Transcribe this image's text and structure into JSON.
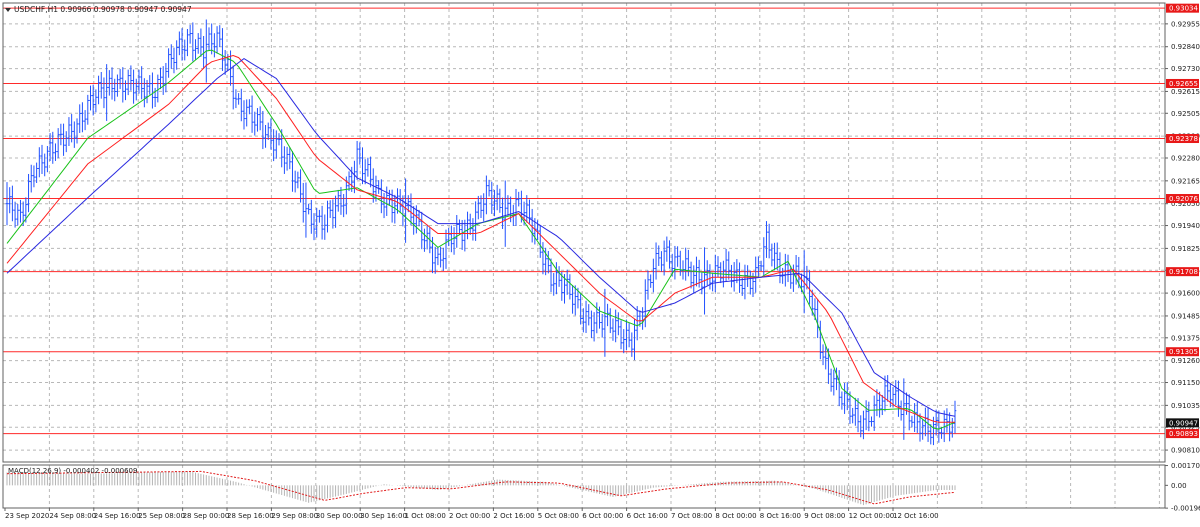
{
  "header": {
    "symbol_line": "USDCHF,H1  0.90966 0.90978 0.90947 0.90947"
  },
  "colors": {
    "background": "#ffffff",
    "grid": "#b8b8b8",
    "candles": "#2050ff",
    "ma_fast": "#19c219",
    "ma_mid": "#ff2020",
    "ma_slow": "#2a2ae0",
    "level_line": "#ff2a2a",
    "level_label_bg": "#e81818",
    "price_label_bg": "#101010",
    "macd_hist": "#b4b4b4",
    "macd_signal": "#e01818"
  },
  "chart_data": [
    {
      "type": "line",
      "title": "",
      "series_style": "candlestick-bars",
      "grid": true,
      "x": [
        "23 Sep 2020",
        "24 Sep 08:00",
        "24 Sep 16:00",
        "25 Sep 08:00",
        "28 Sep 00:00",
        "28 Sep 16:00",
        "29 Sep 08:00",
        "30 Sep 00:00",
        "30 Sep 16:00",
        "1 Oct 08:00",
        "2 Oct 00:00",
        "2 Oct 16:00",
        "5 Oct 08:00",
        "6 Oct 00:00",
        "6 Oct 16:00",
        "7 Oct 08:00",
        "8 Oct 00:00",
        "8 Oct 16:00",
        "9 Oct 08:00",
        "12 Oct 00:00",
        "12 Oct 16:00"
      ],
      "ylim": [
        0.9075,
        0.9306
      ],
      "y_ticks": [
        "0.92955",
        "0.92840",
        "0.92730",
        "0.92615",
        "0.92505",
        "0.92390",
        "0.92280",
        "0.92165",
        "0.92050",
        "0.91940",
        "0.91825",
        "0.91715",
        "0.91600",
        "0.91485",
        "0.91375",
        "0.91260",
        "0.91150",
        "0.91035",
        "0.90925",
        "0.90810"
      ],
      "y_tick_values": [
        0.92955,
        0.9284,
        0.9273,
        0.92615,
        0.92505,
        0.9239,
        0.9228,
        0.92165,
        0.9205,
        0.9194,
        0.91825,
        0.91715,
        0.916,
        0.91485,
        0.91375,
        0.9126,
        0.9115,
        0.91035,
        0.90925,
        0.9081
      ],
      "levels": [
        {
          "label": "0.93034",
          "value": 0.93034
        },
        {
          "label": "0.92655",
          "value": 0.92655
        },
        {
          "label": "0.92378",
          "value": 0.92378
        },
        {
          "label": "0.92076",
          "value": 0.92076
        },
        {
          "label": "0.91708",
          "value": 0.91708
        },
        {
          "label": "0.91305",
          "value": 0.91305
        },
        {
          "label": "0.90893",
          "value": 0.90893
        }
      ],
      "current_price": {
        "label": "0.90947",
        "value": 0.90947
      },
      "price_keypoints": [
        [
          0,
          0.9205
        ],
        [
          5,
          0.9195
        ],
        [
          10,
          0.9225
        ],
        [
          18,
          0.9232
        ],
        [
          25,
          0.9245
        ],
        [
          33,
          0.9258
        ],
        [
          40,
          0.9268
        ],
        [
          48,
          0.9262
        ],
        [
          55,
          0.9264
        ],
        [
          62,
          0.9278
        ],
        [
          68,
          0.929
        ],
        [
          73,
          0.9283
        ],
        [
          78,
          0.9286
        ],
        [
          82,
          0.9275
        ],
        [
          86,
          0.9255
        ],
        [
          92,
          0.9245
        ],
        [
          100,
          0.9238
        ],
        [
          106,
          0.9218
        ],
        [
          112,
          0.92
        ],
        [
          118,
          0.9195
        ],
        [
          124,
          0.9205
        ],
        [
          130,
          0.923
        ],
        [
          134,
          0.9218
        ],
        [
          138,
          0.9208
        ],
        [
          144,
          0.9207
        ],
        [
          150,
          0.9198
        ],
        [
          156,
          0.9188
        ],
        [
          160,
          0.9176
        ],
        [
          166,
          0.9188
        ],
        [
          172,
          0.9196
        ],
        [
          178,
          0.9208
        ],
        [
          184,
          0.9203
        ],
        [
          190,
          0.9205
        ],
        [
          196,
          0.919
        ],
        [
          202,
          0.917
        ],
        [
          208,
          0.916
        ],
        [
          214,
          0.915
        ],
        [
          220,
          0.9145
        ],
        [
          226,
          0.9142
        ],
        [
          232,
          0.9138
        ],
        [
          236,
          0.915
        ],
        [
          240,
          0.9173
        ],
        [
          244,
          0.9183
        ],
        [
          248,
          0.9176
        ],
        [
          254,
          0.9168
        ],
        [
          260,
          0.917
        ],
        [
          266,
          0.917
        ],
        [
          272,
          0.9168
        ],
        [
          278,
          0.9168
        ],
        [
          282,
          0.9184
        ],
        [
          286,
          0.9175
        ],
        [
          292,
          0.917
        ],
        [
          298,
          0.916
        ],
        [
          304,
          0.9125
        ],
        [
          310,
          0.9105
        ],
        [
          316,
          0.9097
        ],
        [
          322,
          0.91
        ],
        [
          328,
          0.911
        ],
        [
          334,
          0.9103
        ],
        [
          338,
          0.9092
        ],
        [
          342,
          0.909
        ],
        [
          346,
          0.9095
        ],
        [
          352,
          0.9095
        ]
      ],
      "series": [
        {
          "values": [
            [
              0,
              0.9185
            ],
            [
              30,
              0.9238
            ],
            [
              60,
              0.9266
            ],
            [
              75,
              0.9283
            ],
            [
              85,
              0.9276
            ],
            [
              100,
              0.9245
            ],
            [
              115,
              0.921
            ],
            [
              130,
              0.9213
            ],
            [
              145,
              0.9202
            ],
            [
              160,
              0.9183
            ],
            [
              175,
              0.9195
            ],
            [
              190,
              0.92
            ],
            [
              205,
              0.917
            ],
            [
              220,
              0.9151
            ],
            [
              235,
              0.9143
            ],
            [
              248,
              0.9172
            ],
            [
              262,
              0.917
            ],
            [
              280,
              0.9168
            ],
            [
              290,
              0.9176
            ],
            [
              300,
              0.9148
            ],
            [
              310,
              0.9112
            ],
            [
              320,
              0.9101
            ],
            [
              335,
              0.9102
            ],
            [
              345,
              0.9091
            ],
            [
              352,
              0.9095
            ]
          ]
        },
        {
          "values": [
            [
              0,
              0.9175
            ],
            [
              30,
              0.9225
            ],
            [
              60,
              0.9255
            ],
            [
              75,
              0.9276
            ],
            [
              85,
              0.928
            ],
            [
              100,
              0.9258
            ],
            [
              115,
              0.9228
            ],
            [
              130,
              0.9212
            ],
            [
              145,
              0.9206
            ],
            [
              160,
              0.919
            ],
            [
              175,
              0.919
            ],
            [
              190,
              0.92
            ],
            [
              205,
              0.918
            ],
            [
              220,
              0.916
            ],
            [
              235,
              0.9145
            ],
            [
              248,
              0.916
            ],
            [
              262,
              0.9168
            ],
            [
              280,
              0.9168
            ],
            [
              292,
              0.9172
            ],
            [
              305,
              0.915
            ],
            [
              318,
              0.9115
            ],
            [
              330,
              0.9103
            ],
            [
              345,
              0.9095
            ],
            [
              352,
              0.9095
            ]
          ]
        },
        {
          "values": [
            [
              0,
              0.917
            ],
            [
              30,
              0.9208
            ],
            [
              60,
              0.9245
            ],
            [
              78,
              0.9268
            ],
            [
              88,
              0.9278
            ],
            [
              100,
              0.9268
            ],
            [
              115,
              0.924
            ],
            [
              130,
              0.9218
            ],
            [
              145,
              0.9208
            ],
            [
              160,
              0.9195
            ],
            [
              175,
              0.9195
            ],
            [
              190,
              0.9201
            ],
            [
              205,
              0.9188
            ],
            [
              220,
              0.9168
            ],
            [
              235,
              0.915
            ],
            [
              248,
              0.9155
            ],
            [
              262,
              0.9165
            ],
            [
              280,
              0.9168
            ],
            [
              295,
              0.917
            ],
            [
              310,
              0.915
            ],
            [
              322,
              0.912
            ],
            [
              335,
              0.9108
            ],
            [
              345,
              0.91
            ],
            [
              352,
              0.9098
            ]
          ]
        }
      ]
    },
    {
      "type": "bar",
      "title": "MACD(12,26,9) -0.000402 -0.000609",
      "ylim": [
        -0.00195,
        0.00175
      ],
      "y_ticks": [
        "0.001704",
        "0.00",
        "-0.001961"
      ],
      "y_tick_values": [
        0.001704,
        0.0,
        -0.001961
      ],
      "hist_keypoints": [
        [
          0,
          0.0011
        ],
        [
          30,
          0.001
        ],
        [
          68,
          0.0012
        ],
        [
          85,
          0.0003
        ],
        [
          112,
          -0.0015
        ],
        [
          125,
          -0.0008
        ],
        [
          140,
          0.0001
        ],
        [
          160,
          -0.0004
        ],
        [
          182,
          0.0005
        ],
        [
          200,
          0.0003
        ],
        [
          225,
          -0.001
        ],
        [
          240,
          -0.0002
        ],
        [
          265,
          0.0003
        ],
        [
          285,
          0.0004
        ],
        [
          300,
          -0.0003
        ],
        [
          318,
          -0.0017
        ],
        [
          330,
          -0.0009
        ],
        [
          345,
          -0.0004
        ],
        [
          352,
          -0.0004
        ]
      ],
      "signal_keypoints": [
        [
          0,
          0.001
        ],
        [
          35,
          0.0011
        ],
        [
          72,
          0.0012
        ],
        [
          92,
          0.0004
        ],
        [
          118,
          -0.0013
        ],
        [
          132,
          -0.0007
        ],
        [
          148,
          -0.0002
        ],
        [
          165,
          -0.0003
        ],
        [
          185,
          0.0003
        ],
        [
          205,
          0.0002
        ],
        [
          228,
          -0.0009
        ],
        [
          245,
          -0.0003
        ],
        [
          268,
          0.0002
        ],
        [
          288,
          0.0003
        ],
        [
          305,
          -0.0004
        ],
        [
          322,
          -0.0016
        ],
        [
          335,
          -0.001
        ],
        [
          352,
          -0.0006
        ]
      ]
    }
  ]
}
